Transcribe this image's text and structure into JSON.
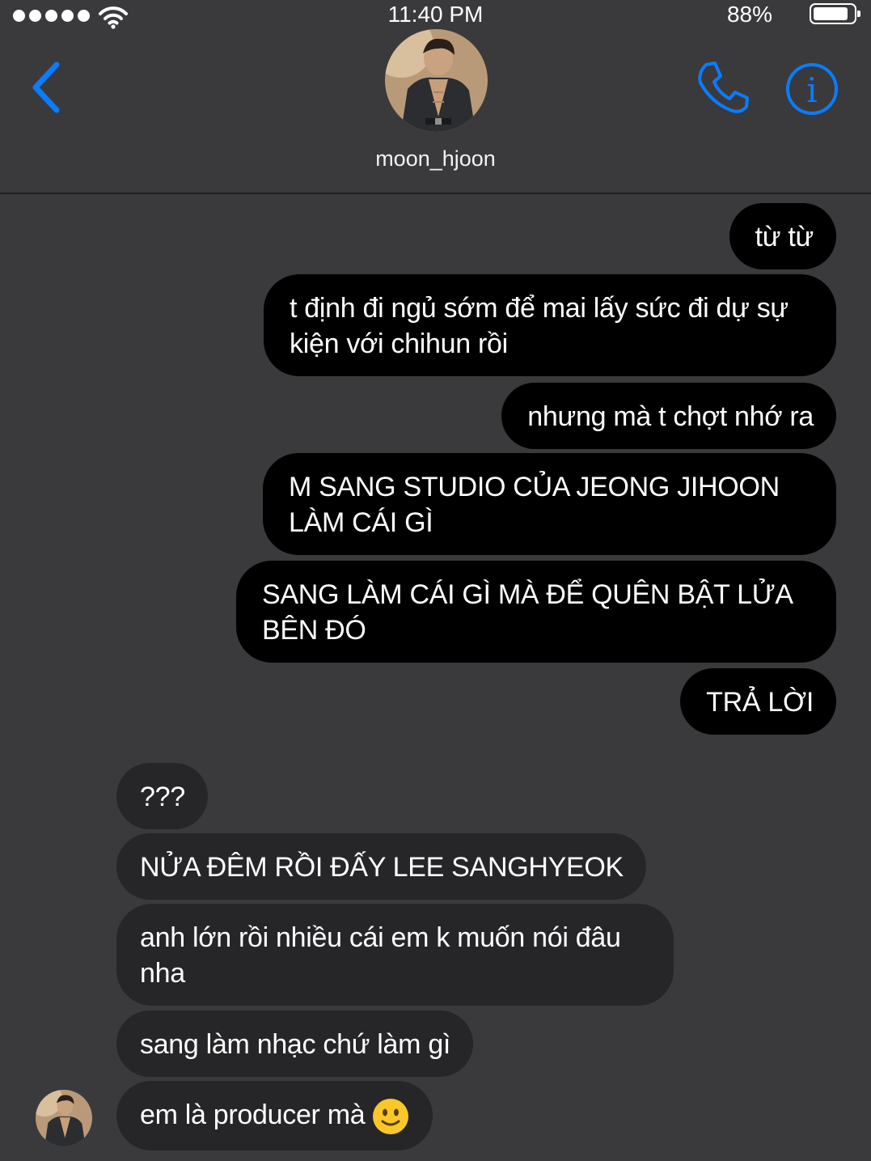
{
  "status_bar": {
    "time": "11:40 PM",
    "battery_percent": "88%",
    "signal_dots": 5,
    "battery_level": 0.88
  },
  "header": {
    "username": "moon_hjoon",
    "back_icon": "chevron-left-icon",
    "call_icon": "phone-icon",
    "info_icon": "info-icon",
    "accent_color": "#0a7cff"
  },
  "messages": [
    {
      "side": "sent",
      "text": "từ từ"
    },
    {
      "side": "sent",
      "text": "t định đi ngủ sớm để mai lấy sức đi dự sự kiện với chihun rồi"
    },
    {
      "side": "sent",
      "text": "nhưng mà t chợt nhớ ra"
    },
    {
      "side": "sent",
      "text": "M SANG STUDIO CỦA JEONG JIHOON LÀM CÁI GÌ"
    },
    {
      "side": "sent",
      "text": "SANG LÀM CÁI GÌ MÀ ĐỂ QUÊN BẬT LỬA BÊN ĐÓ"
    },
    {
      "side": "sent",
      "text": "TRẢ LỜI"
    },
    {
      "side": "received",
      "text": "???"
    },
    {
      "side": "received",
      "text": "NỬA ĐÊM RỒI ĐẤY LEE SANGHYEOK"
    },
    {
      "side": "received",
      "text": "anh lớn rồi nhiều cái em k muốn nói đâu nha"
    },
    {
      "side": "received",
      "text": "sang làm nhạc chứ làm gì"
    },
    {
      "side": "received",
      "text": "em là producer mà",
      "emoji": "slightly-smiling-face"
    }
  ],
  "colors": {
    "background": "#3a3a3c",
    "sent_bubble": "#000000",
    "received_bubble": "#262628"
  }
}
